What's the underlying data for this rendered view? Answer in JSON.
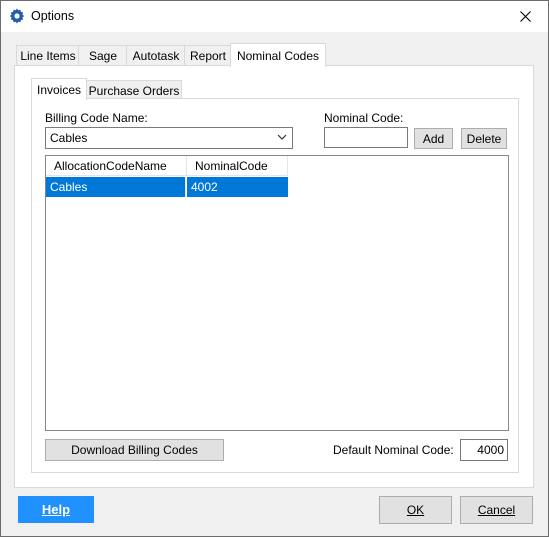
{
  "window": {
    "title": "Options",
    "icon": "gear-icon"
  },
  "tabs": [
    {
      "label": "Line Items",
      "active": false
    },
    {
      "label": "Sage",
      "active": false
    },
    {
      "label": "Autotask",
      "active": false
    },
    {
      "label": "Report",
      "active": false
    },
    {
      "label": "Nominal Codes",
      "active": true
    }
  ],
  "subtabs": [
    {
      "label": "Invoices",
      "active": true
    },
    {
      "label": "Purchase Orders",
      "active": false
    }
  ],
  "billing_code": {
    "label": "Billing Code Name:",
    "value": "Cables"
  },
  "nominal_code": {
    "label": "Nominal Code:",
    "value": ""
  },
  "buttons": {
    "add": "Add",
    "delete": "Delete",
    "download": "Download Billing Codes",
    "help": "Help",
    "ok": "OK",
    "cancel": "Cancel"
  },
  "grid": {
    "columns": [
      "AllocationCodeName",
      "NominalCode"
    ],
    "rows": [
      {
        "name": "Cables",
        "code": "4002",
        "selected": true
      }
    ]
  },
  "default_nominal": {
    "label": "Default Nominal Code:",
    "value": "4000"
  },
  "colors": {
    "selection": "#0078d7",
    "help_button": "#1e90ff"
  }
}
